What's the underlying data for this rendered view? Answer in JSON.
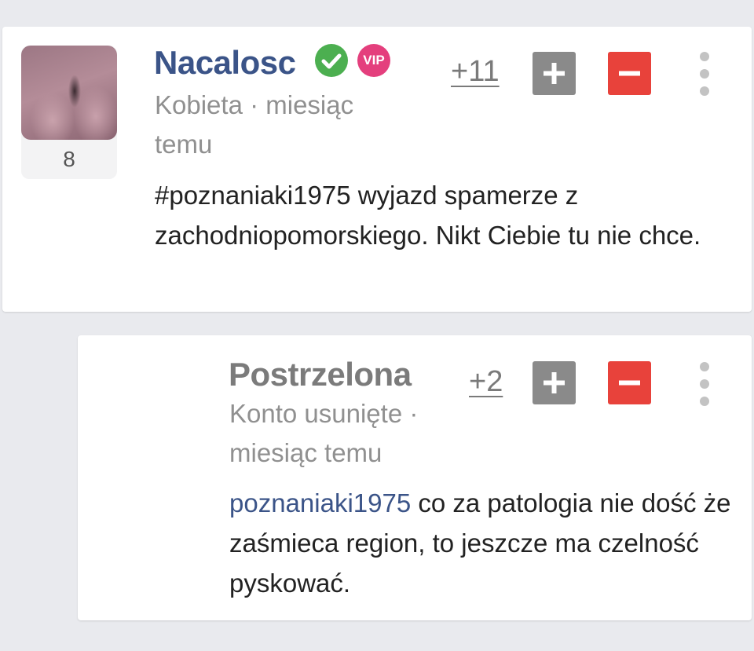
{
  "post": {
    "username": "Nacalosc",
    "vip_label": "VIP",
    "meta": "Kobieta · miesiąc temu",
    "body": "#poznaniaki1975 wyjazd spamerze z zachodniopomorskiego. Nikt Ciebie tu nie chce.",
    "score": "+11",
    "avatar_count": "8"
  },
  "reply": {
    "username": "Postrzelona",
    "meta": "Konto usunięte · miesiąc temu",
    "mention": "poznaniaki1975",
    "body": " co za patologia nie dość że zaśmieca region, to jeszcze ma czelność pyskować.",
    "score": "+2"
  },
  "colors": {
    "background": "#e9eaee",
    "username_link": "#3b5488",
    "deleted_username": "#7b7b7b",
    "verified": "#4caf50",
    "vip": "#e43f7d",
    "upvote": "#8a8a8a",
    "downvote": "#e8423b"
  },
  "icons": {
    "verified": "verified-check-icon",
    "vip": "vip-badge-icon",
    "plus": "plus-icon",
    "minus": "minus-icon",
    "more": "more-vertical-icon"
  }
}
